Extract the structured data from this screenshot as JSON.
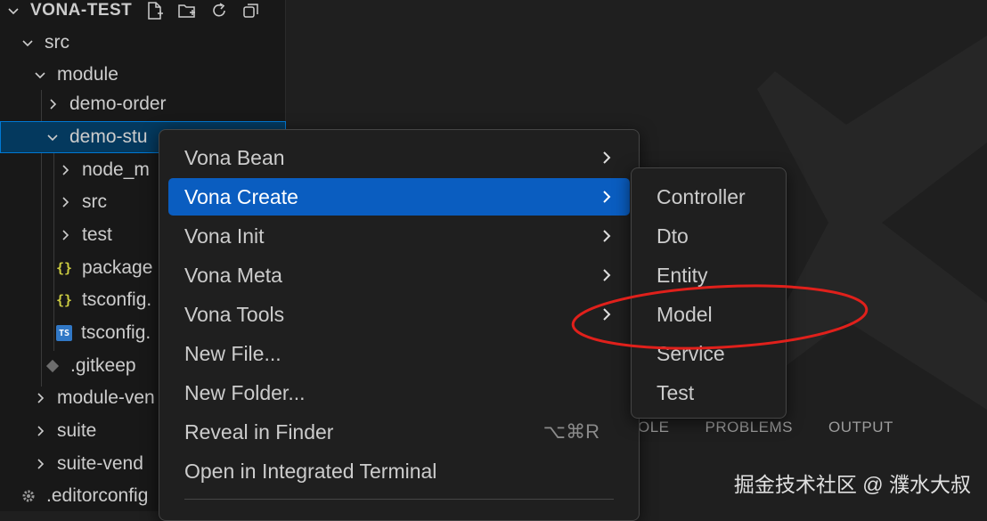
{
  "explorer": {
    "project_title": "VONA-TEST",
    "tree": [
      {
        "label": "src",
        "kind": "folder-open"
      },
      {
        "label": "module",
        "kind": "folder-open"
      },
      {
        "label": "demo-order",
        "kind": "folder-closed"
      },
      {
        "label": "demo-stu",
        "kind": "folder-open",
        "selected": true
      },
      {
        "label": "node_m",
        "kind": "folder-closed"
      },
      {
        "label": "src",
        "kind": "folder-closed"
      },
      {
        "label": "test",
        "kind": "folder-closed"
      },
      {
        "label": "package",
        "kind": "json-file",
        "icon_text": "{}"
      },
      {
        "label": "tsconfig.",
        "kind": "json-file",
        "icon_text": "{}"
      },
      {
        "label": "tsconfig.",
        "kind": "ts-file",
        "icon_text": "TS"
      },
      {
        "label": ".gitkeep",
        "kind": "git-file"
      },
      {
        "label": "module-ven",
        "kind": "folder-closed"
      },
      {
        "label": "suite",
        "kind": "folder-closed"
      },
      {
        "label": "suite-vend",
        "kind": "folder-closed"
      },
      {
        "label": ".editorconfig",
        "kind": "config-file"
      }
    ]
  },
  "context_menu": {
    "items": [
      {
        "label": "Vona Bean",
        "has_submenu": true
      },
      {
        "label": "Vona Create",
        "has_submenu": true,
        "active": true
      },
      {
        "label": "Vona Init",
        "has_submenu": true
      },
      {
        "label": "Vona Meta",
        "has_submenu": true
      },
      {
        "label": "Vona Tools",
        "has_submenu": true
      },
      {
        "label": "New File...",
        "has_submenu": false
      },
      {
        "label": "New Folder...",
        "has_submenu": false
      },
      {
        "label": "Reveal in Finder",
        "has_submenu": false,
        "shortcut": "⌥⌘R"
      },
      {
        "label": "Open in Integrated Terminal",
        "has_submenu": false
      }
    ]
  },
  "submenu": {
    "items": [
      "Controller",
      "Dto",
      "Entity",
      "Model",
      "Service",
      "Test"
    ],
    "highlighted": "Model",
    "highlight_color": "#e0201b"
  },
  "panel": {
    "tabs": [
      "OLE",
      "PROBLEMS",
      "OUTPUT"
    ]
  },
  "credit": "掘金技术社区 @ 濮水大叔",
  "colors": {
    "sidebar_bg": "#181818",
    "selection": "#04395e",
    "menu_active": "#0a5dc0",
    "menu_bg": "#1f1f1f"
  }
}
